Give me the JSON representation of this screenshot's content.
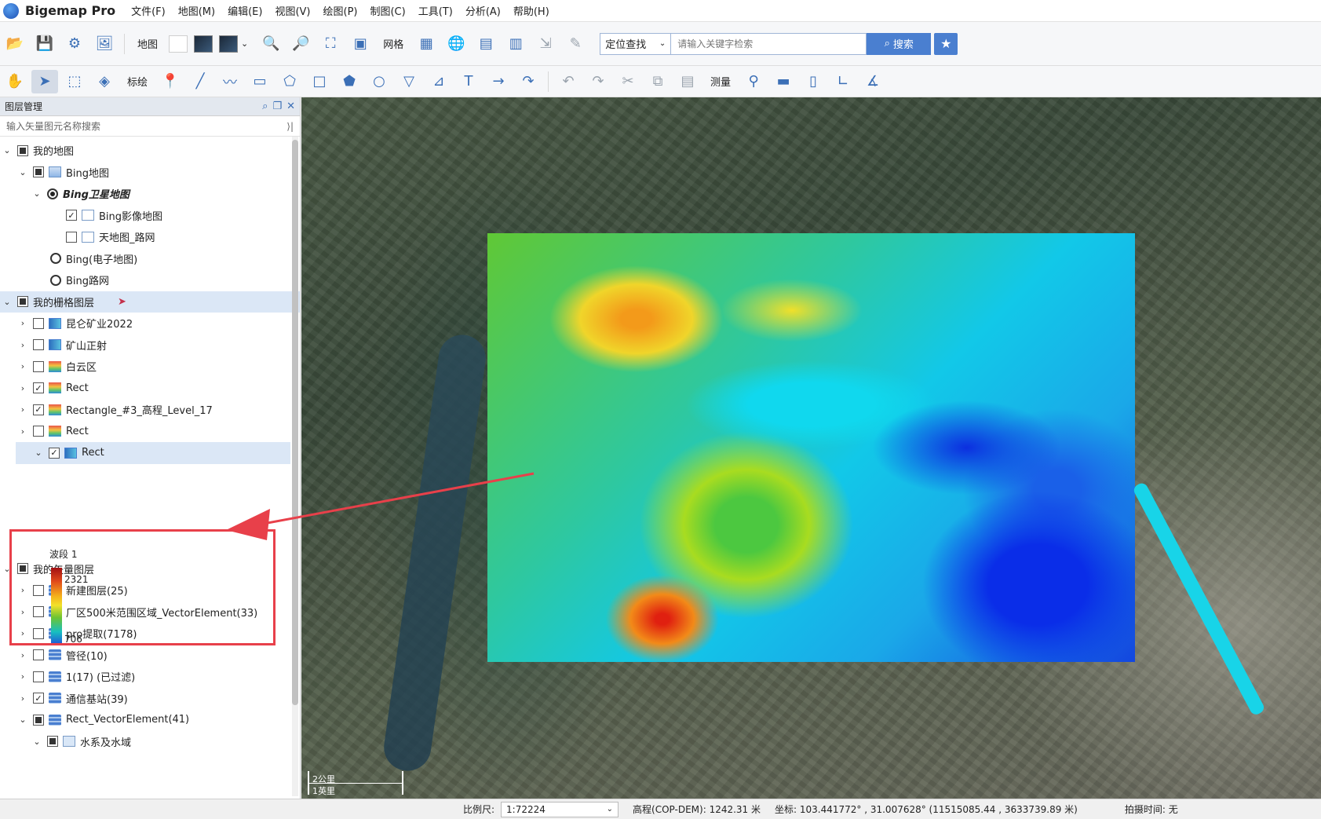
{
  "app": {
    "title": "Bigemap Pro"
  },
  "menu": [
    "文件(F)",
    "地图(M)",
    "编辑(E)",
    "视图(V)",
    "绘图(P)",
    "制图(C)",
    "工具(T)",
    "分析(A)",
    "帮助(H)"
  ],
  "toolbar1": {
    "map_label": "地图",
    "grid_label": "网格",
    "search_mode": "定位查找",
    "search_placeholder": "请输入关键字检索",
    "search_button": "搜索"
  },
  "toolbar2": {
    "mark_label": "标绘",
    "measure_label": "测量"
  },
  "panel": {
    "title": "图层管理",
    "search_placeholder": "输入矢量图元名称搜索"
  },
  "tree": {
    "my_maps": "我的地图",
    "bing_maps": "Bing地图",
    "bing_satellite": "Bing卫星地图",
    "bing_imagery": "Bing影像地图",
    "tianditu_road": "天地图_路网",
    "bing_electronic": "Bing(电子地图)",
    "bing_road": "Bing路网",
    "raster_layers": "我的栅格图层",
    "kunlun": "昆仑矿业2022",
    "mine_ortho": "矿山正射",
    "baiyun": "白云区",
    "rect1": "Rect",
    "rectangle3": "Rectangle_#3_高程_Level_17",
    "rect2": "Rect",
    "rect3": "Rect",
    "vector_layers": "我的矢量图层",
    "new_layer": "新建图层(25)",
    "plant_area": "厂区500米范围区域_VectorElement(33)",
    "pro_extract": "pro提取(7178)",
    "pipeline": "管径(10)",
    "filtered": "1(17) (已过滤)",
    "comm_station": "通信基站(39)",
    "rect_vector": "Rect_VectorElement(41)",
    "water": "水系及水域"
  },
  "legend": {
    "band": "波段 1",
    "max": "2321",
    "min": "706",
    "colors": [
      "#a30f12",
      "#e04a1b",
      "#f5b21c",
      "#f2e12a",
      "#6ec431",
      "#17c0c0",
      "#1f5fd6"
    ]
  },
  "map": {
    "scale_km": "2公里",
    "scale_mile": "1英里"
  },
  "status": {
    "scale_label": "比例尺:",
    "scale_value": "1:72224",
    "elevation": "高程(COP-DEM): 1242.31 米",
    "coords": "坐标: 103.441772° , 31.007628°  (11515085.44 , 3633739.89 米)",
    "capture_time": "拍摄时间: 无"
  },
  "colors": {
    "accent": "#4a7fd0",
    "annotation": "#e8404a"
  }
}
